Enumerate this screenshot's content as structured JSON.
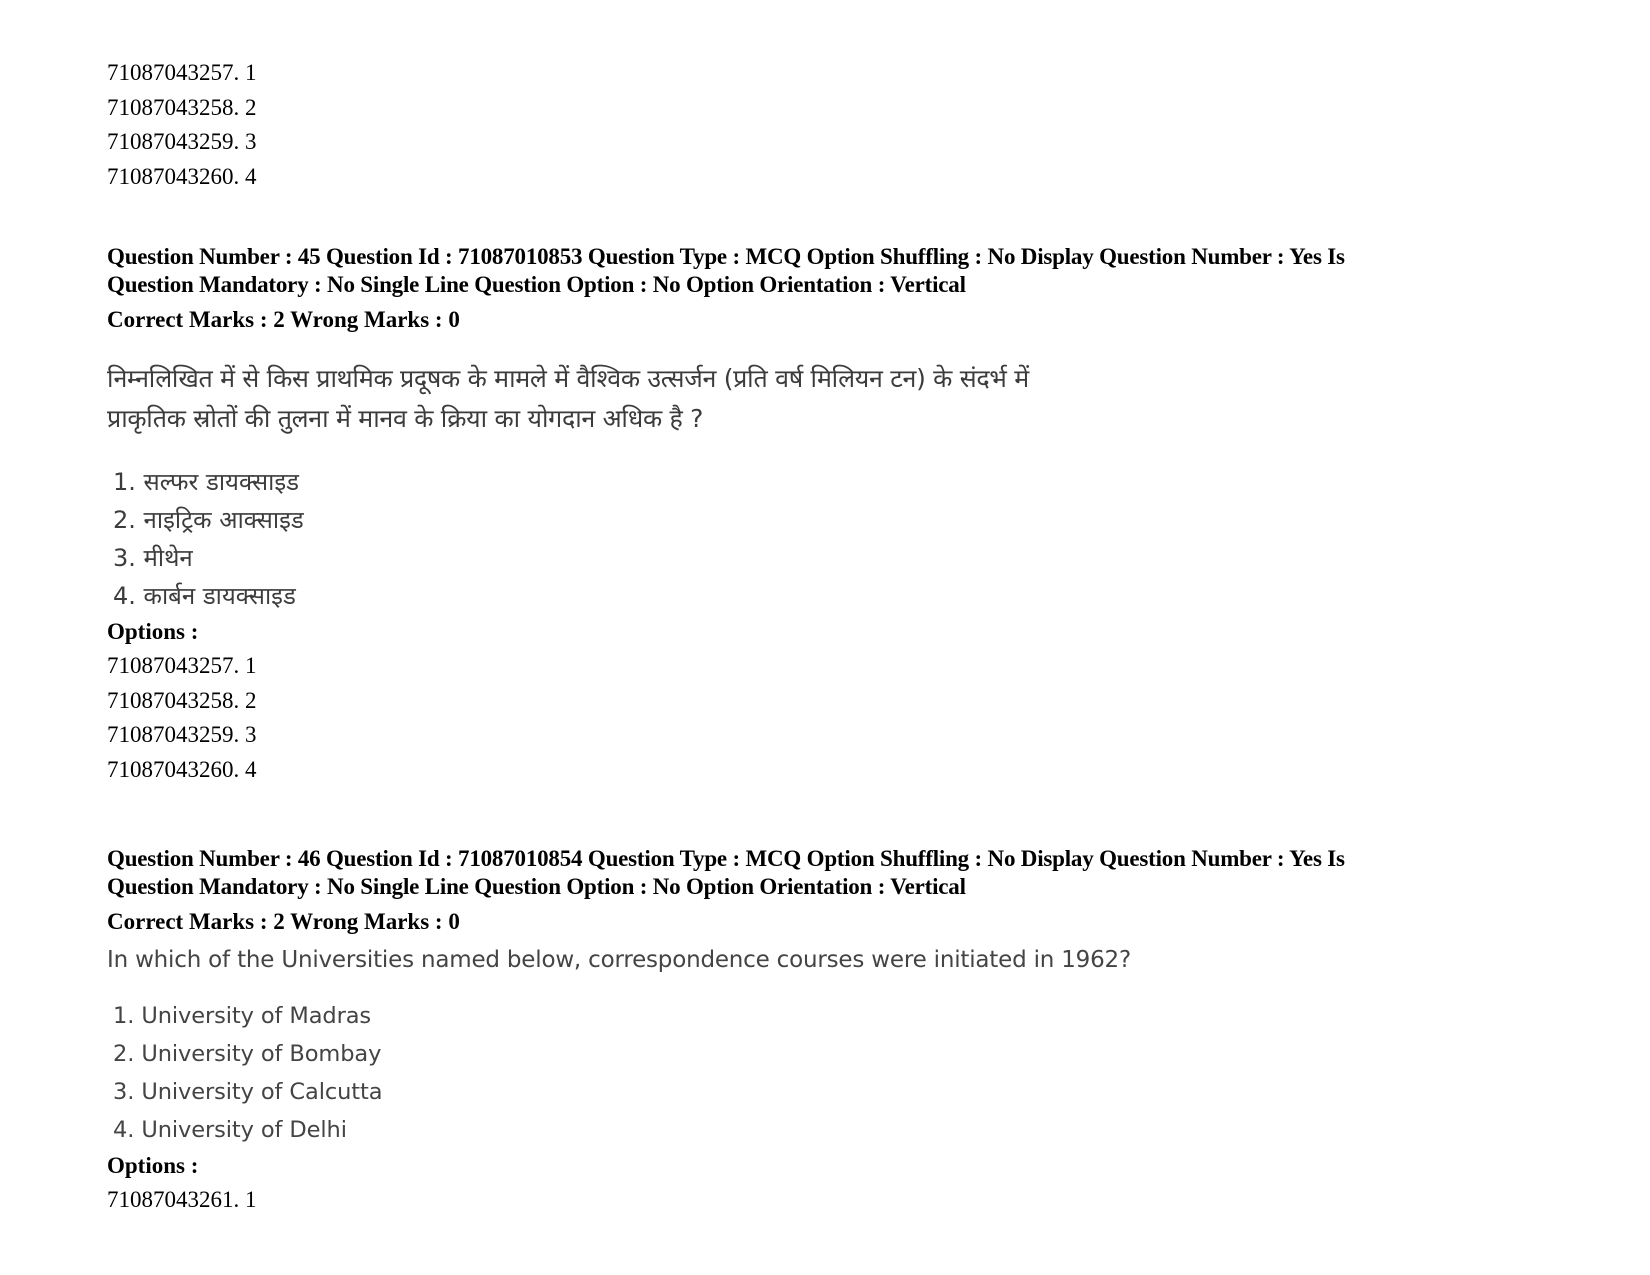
{
  "top_options": [
    "71087043257. 1",
    "71087043258. 2",
    "71087043259. 3",
    "71087043260. 4"
  ],
  "questions": [
    {
      "meta_line1": "Question Number : 45 Question Id : 71087010853 Question Type : MCQ Option Shuffling : No Display Question Number : Yes Is",
      "meta_line2": "Question Mandatory : No Single Line Question Option : No Option Orientation : Vertical",
      "marks": "Correct Marks : 2 Wrong Marks : 0",
      "question_lines": [
        "निम्नलिखित में से किस प्राथमिक प्रदूषक के मामले में वैश्विक उत्सर्जन (प्रति वर्ष मिलियन टन) के संदर्भ में",
        "प्राकृतिक स्रोतों की तुलना में मानव के क्रिया का योगदान अधिक है ?"
      ],
      "choices": [
        "1. सल्फर डायक्साइड",
        "2. नाइट्रिक आक्साइड",
        "3. मीथेन",
        "4. कार्बन डायक्साइड"
      ],
      "options_label": "Options :",
      "options": [
        "71087043257. 1",
        "71087043258. 2",
        "71087043259. 3",
        "71087043260. 4"
      ]
    },
    {
      "meta_line1": "Question Number : 46 Question Id : 71087010854 Question Type : MCQ Option Shuffling : No Display Question Number : Yes Is",
      "meta_line2": "Question Mandatory : No Single Line Question Option : No Option Orientation : Vertical",
      "marks": "Correct Marks : 2 Wrong Marks : 0",
      "question_lines": [
        "In which of the Universities named below, correspondence courses were initiated in 1962?"
      ],
      "choices": [
        "1. University of Madras",
        "2. University of Bombay",
        "3. University of Calcutta",
        "4. University of Delhi"
      ],
      "options_label": "Options :",
      "options": [
        "71087043261. 1"
      ]
    }
  ]
}
